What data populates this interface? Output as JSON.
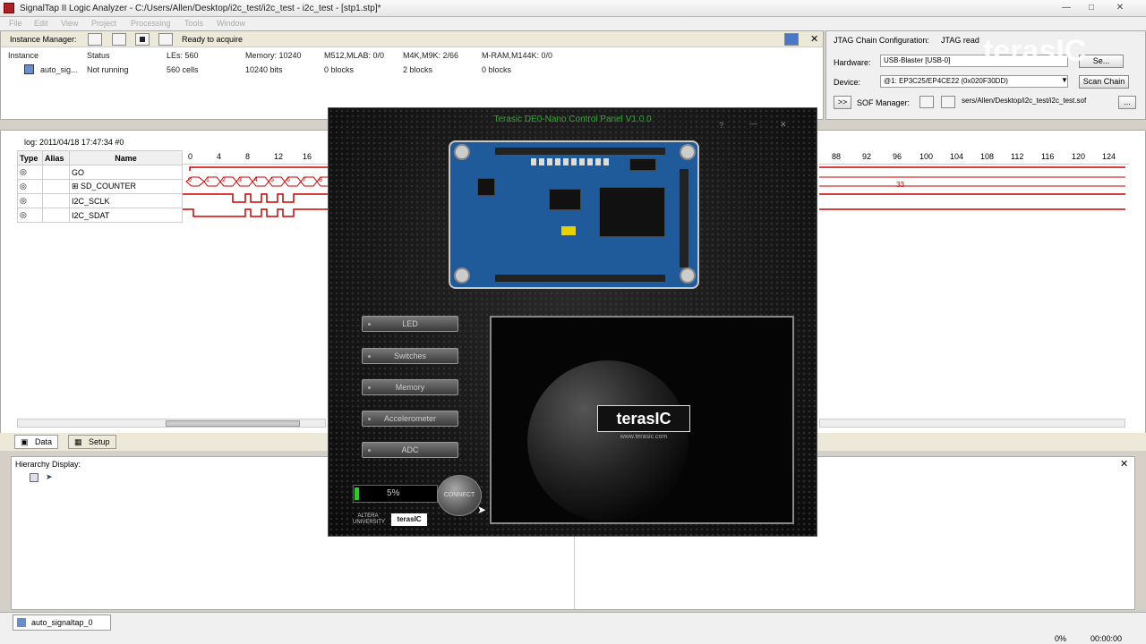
{
  "window": {
    "title": "SignalTap II Logic Analyzer - C:/Users/Allen/Desktop/i2c_test/i2c_test - i2c_test - [stp1.stp]*"
  },
  "menu": [
    "File",
    "Edit",
    "View",
    "Project",
    "Processing",
    "Tools",
    "Window"
  ],
  "instance_manager": {
    "label": "Instance Manager:",
    "status_text": "Ready to acquire",
    "headers": [
      "Instance",
      "Status",
      "LEs: 560",
      "Memory: 10240",
      "M512,MLAB: 0/0",
      "M4K,M9K: 2/66",
      "M-RAM,M144K: 0/0"
    ],
    "row": [
      "auto_sig...",
      "Not running",
      "560 cells",
      "10240 bits",
      "0 blocks",
      "2 blocks",
      "0 blocks"
    ]
  },
  "jtag": {
    "title": "JTAG Chain Configuration:",
    "status": "JTAG read",
    "hardware_label": "Hardware:",
    "hardware_value": "USB-Blaster [USB-0]",
    "setup_button": "Se...",
    "device_label": "Device:",
    "device_value": "@1: EP3C25/EP4CE22 (0x020F30DD)",
    "scan_button": "Scan Chain",
    "sof_label": "SOF Manager:",
    "sof_value": "sers/Allen/Desktop/i2c_test/i2c_test.sof",
    "arrow_button": ">>",
    "more_button": "..."
  },
  "waveform": {
    "log": "log: 2011/04/18 17:47:34  #0",
    "columns": [
      "Type",
      "Alias",
      "Name"
    ],
    "ticks_left": [
      "0",
      "4",
      "8",
      "12",
      "16"
    ],
    "ticks_right": [
      "88",
      "92",
      "96",
      "100",
      "104",
      "108",
      "112",
      "116",
      "120",
      "124"
    ],
    "signals": [
      "GO",
      "SD_COUNTER",
      "I2C_SCLK",
      "I2C_SDAT"
    ],
    "counter_values": [
      "0",
      "1",
      "2",
      "3",
      "4",
      "5",
      "6",
      "7",
      "8"
    ],
    "counter_right": "33"
  },
  "tabs": {
    "data": "Data",
    "setup": "Setup"
  },
  "hierarchy": {
    "title": "Hierarchy Display:"
  },
  "statusbar": {
    "instance_tab": "auto_signaltap_0",
    "percent": "0%",
    "time": "00:00:00"
  },
  "control_panel": {
    "title": "Terasic DE0-Nano Control Panel V1.0.0",
    "buttons": [
      "LED",
      "Switches",
      "Memory",
      "Accelerometer",
      "ADC"
    ],
    "progress_value": 0.05,
    "progress_text": "5%",
    "connect_label": "CONNECT",
    "logo_text": "terasIC",
    "logo_url": "www.terasic.com",
    "altera_text": "ALTERA UNIVERSITY",
    "small_logo": "terasIC"
  },
  "watermark": "terasIC",
  "colors": {
    "accent_green": "#36a836",
    "wave_red": "#cc0000",
    "board_blue": "#1f5a9a"
  }
}
